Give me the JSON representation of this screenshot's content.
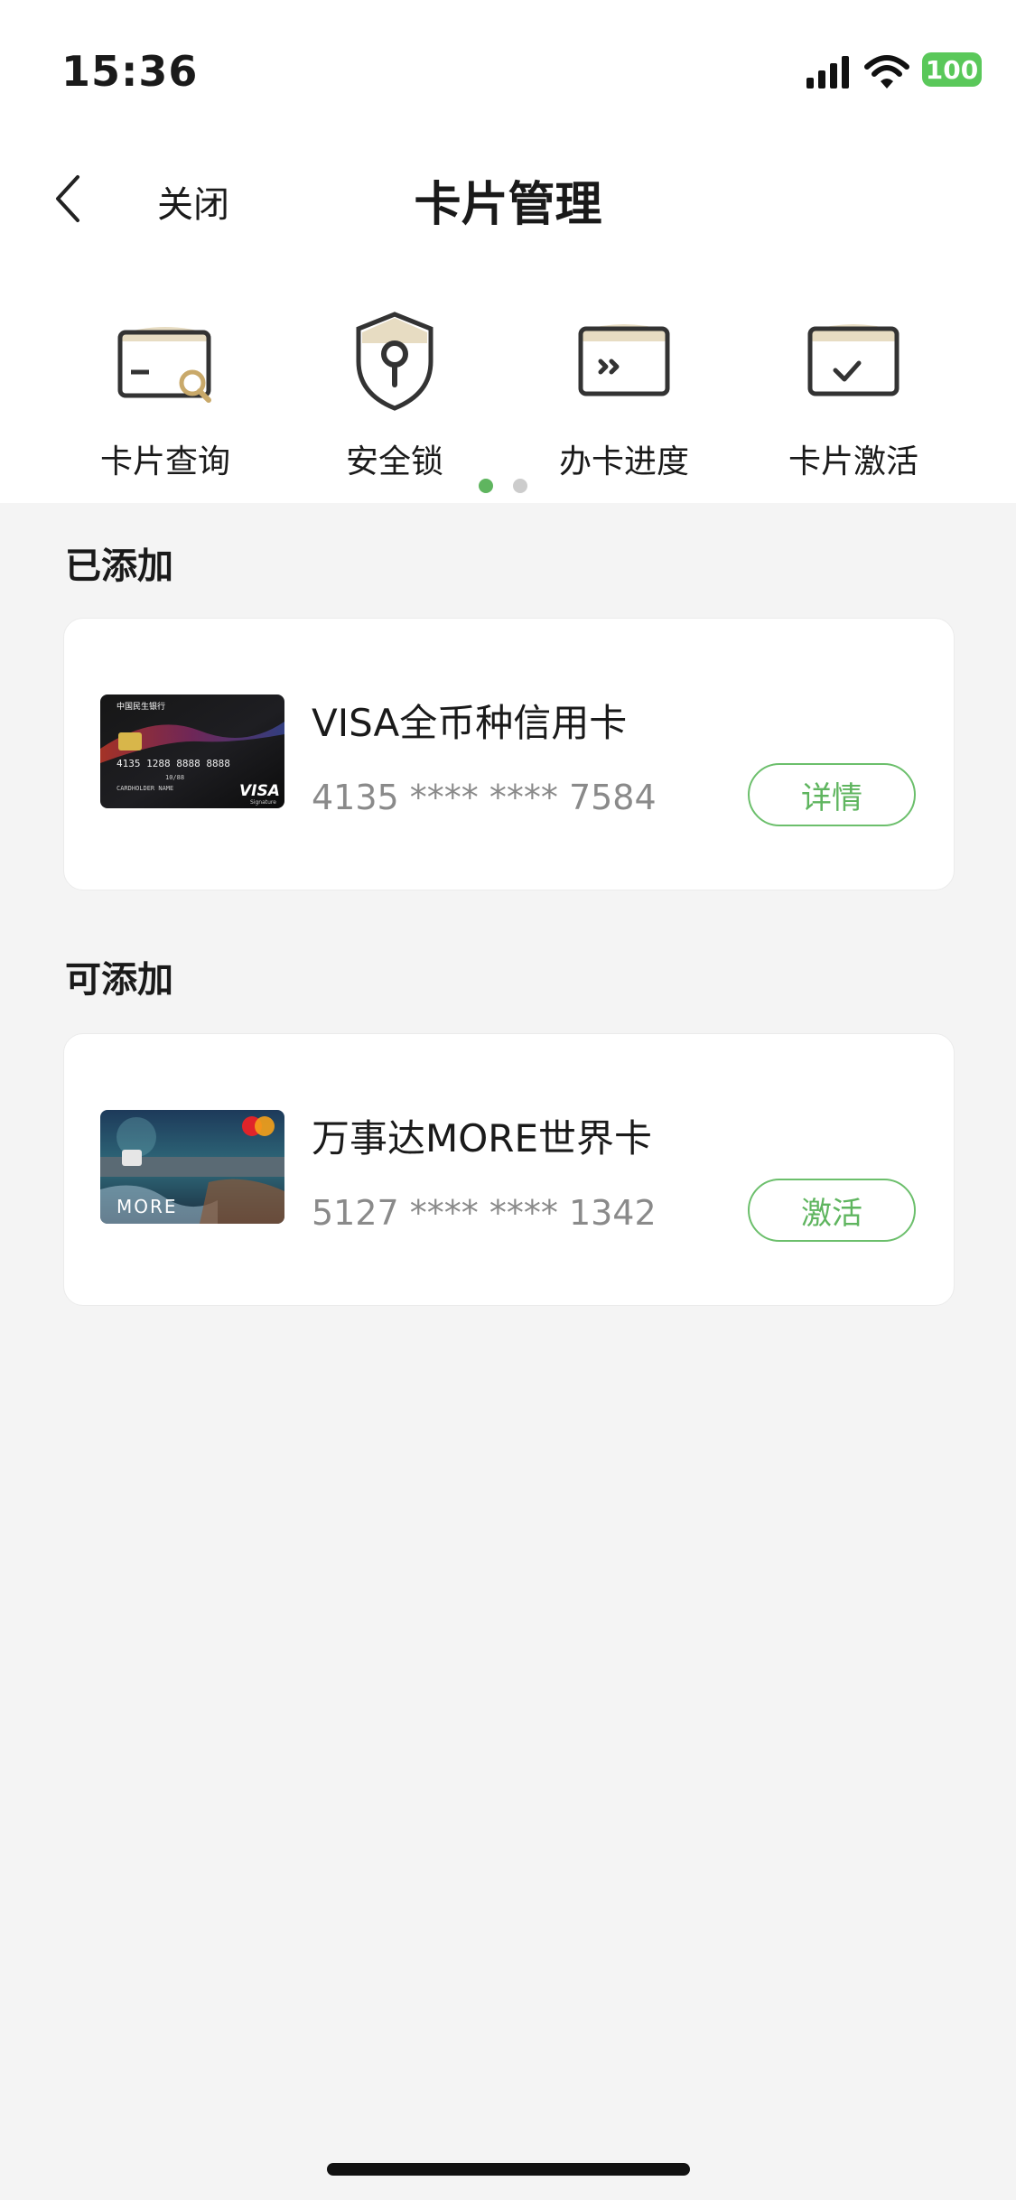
{
  "status_bar": {
    "time": "15:36",
    "battery": "100",
    "battery_color": "#5ac85a"
  },
  "nav": {
    "close_label": "关闭",
    "title": "卡片管理"
  },
  "shortcuts": [
    {
      "label": "卡片查询",
      "icon": "card-search-icon"
    },
    {
      "label": "安全锁",
      "icon": "shield-lock-icon"
    },
    {
      "label": "办卡进度",
      "icon": "card-progress-icon"
    },
    {
      "label": "卡片激活",
      "icon": "card-activate-icon"
    }
  ],
  "pager": {
    "active_color": "#5fb55f",
    "inactive_color": "#cccccc",
    "active_index": 1,
    "total": 2
  },
  "added": {
    "title": "已添加",
    "cards": [
      {
        "name": "VISA全币种信用卡",
        "number": "4135 **** **** 7584",
        "action": "详情"
      }
    ]
  },
  "available": {
    "title": "可添加",
    "cards": [
      {
        "name": "万事达MORE世界卡",
        "number": "5127 **** **** 1342",
        "action": "激活"
      }
    ]
  },
  "card_art": {
    "visa": {
      "bank": "中国民生银行",
      "number": "4135 1288 8888 8888",
      "expiry": "10/88",
      "holder": "CARDHOLDER NAME",
      "brand": "VISA",
      "tier": "Signature"
    },
    "more": {
      "brand_text": "MORE"
    }
  },
  "colors": {
    "accent": "#5fb55f",
    "gold": "#c9a96a"
  }
}
